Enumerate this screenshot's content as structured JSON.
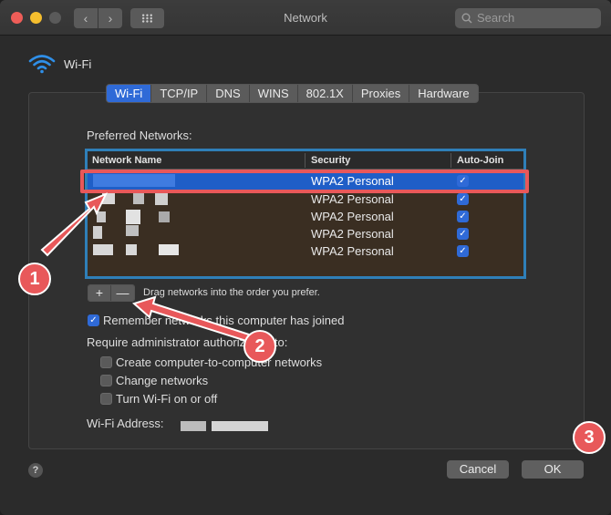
{
  "window": {
    "title": "Network",
    "search_placeholder": "Search",
    "nav_back": "‹",
    "nav_forward": "›"
  },
  "header": {
    "title": "Wi-Fi"
  },
  "tabs": [
    {
      "label": "Wi-Fi",
      "active": true
    },
    {
      "label": "TCP/IP"
    },
    {
      "label": "DNS"
    },
    {
      "label": "WINS"
    },
    {
      "label": "802.1X"
    },
    {
      "label": "Proxies"
    },
    {
      "label": "Hardware"
    }
  ],
  "preferred": {
    "label": "Preferred Networks:",
    "columns": {
      "name": "Network Name",
      "security": "Security",
      "auto_join": "Auto-Join"
    },
    "rows": [
      {
        "name": "",
        "security": "WPA2 Personal",
        "auto_join": true,
        "selected": true
      },
      {
        "name": "",
        "security": "WPA2 Personal",
        "auto_join": true
      },
      {
        "name": "",
        "security": "WPA2 Personal",
        "auto_join": true
      },
      {
        "name": "",
        "security": "WPA2 Personal",
        "auto_join": true
      },
      {
        "name": "",
        "security": "WPA2 Personal",
        "auto_join": true
      }
    ],
    "add_label": "+",
    "remove_label": "—",
    "drag_hint": "Drag networks into the order you prefer."
  },
  "options": {
    "remember": {
      "label": "Remember networks this computer has joined",
      "checked": true
    },
    "require_label": "Require administrator authorization to:",
    "items": [
      {
        "label": "Create computer-to-computer networks",
        "checked": false
      },
      {
        "label": "Change networks",
        "checked": false
      },
      {
        "label": "Turn Wi-Fi on or off",
        "checked": false
      }
    ]
  },
  "address": {
    "label": "Wi-Fi Address:"
  },
  "footer": {
    "help": "?",
    "cancel": "Cancel",
    "ok": "OK"
  },
  "annotations": {
    "badge1": "1",
    "badge2": "2",
    "badge3": "3",
    "color": "#e8585a"
  },
  "colors": {
    "accent": "#2f6ad7",
    "table_border": "#2f7fb8"
  }
}
